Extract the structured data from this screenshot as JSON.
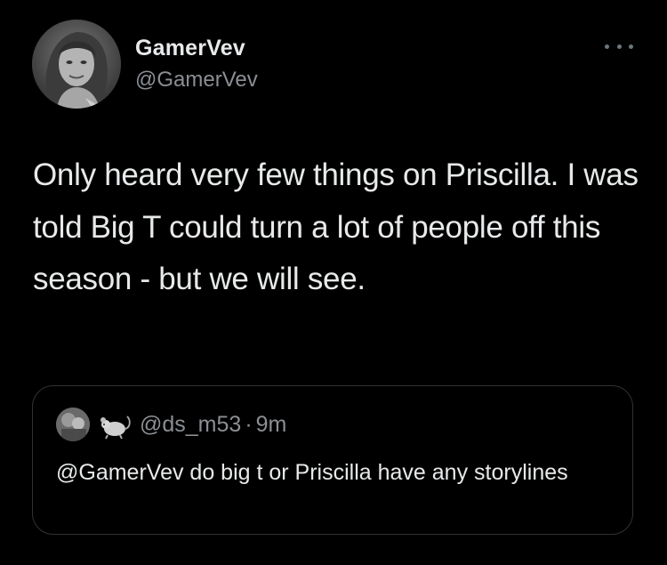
{
  "tweet": {
    "display_name": "GamerVev",
    "handle": "@GamerVev",
    "more_icon": "more-horizontal-icon",
    "text": "Only heard very few things on Priscilla. I was told Big T could turn a lot of people off this season - but we will see."
  },
  "quoted_tweet": {
    "emoji_icon": "rat-emoji-icon",
    "handle": "@ds_m53",
    "separator": "·",
    "time": "9m",
    "text": "@GamerVev do big t or Priscilla have any storylines"
  }
}
